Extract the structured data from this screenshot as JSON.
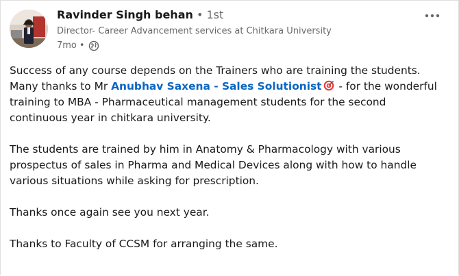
{
  "post": {
    "author": {
      "name": "Ravinder Singh behan",
      "connection_degree": "1st",
      "headline": "Director- Career Advancement services at Chitkara University",
      "time_ago": "7mo",
      "visibility_icon": "globe-icon"
    },
    "menu_icon": "more-horizontal-icon",
    "body": {
      "p1_before": "Success of any course depends on the Trainers who are training the students.",
      "p1_line2_before": "Many thanks to Mr ",
      "mention": "Anubhav Saxena - Sales Solutionist",
      "mention_emoji": "target-icon",
      "p1_line2_after": " - for the wonderful",
      "p1_line3": "training to MBA - Pharmaceutical management students for the second",
      "p1_line4": "continuous year in chitkara university.",
      "p2_line1": "The students are trained by him in Anatomy & Pharmacology with various",
      "p2_line2": "prospectus of sales in Pharma and Medical Devices along with how to handle",
      "p2_line3": "various situations while asking for prescription.",
      "p3": "Thanks once again see you next year.",
      "p4": "Thanks to Faculty of CCSM for arranging the same."
    }
  },
  "colors": {
    "link": "#0a66c2",
    "text_primary": "rgba(0,0,0,0.9)",
    "text_secondary": "rgba(0,0,0,0.6)"
  }
}
